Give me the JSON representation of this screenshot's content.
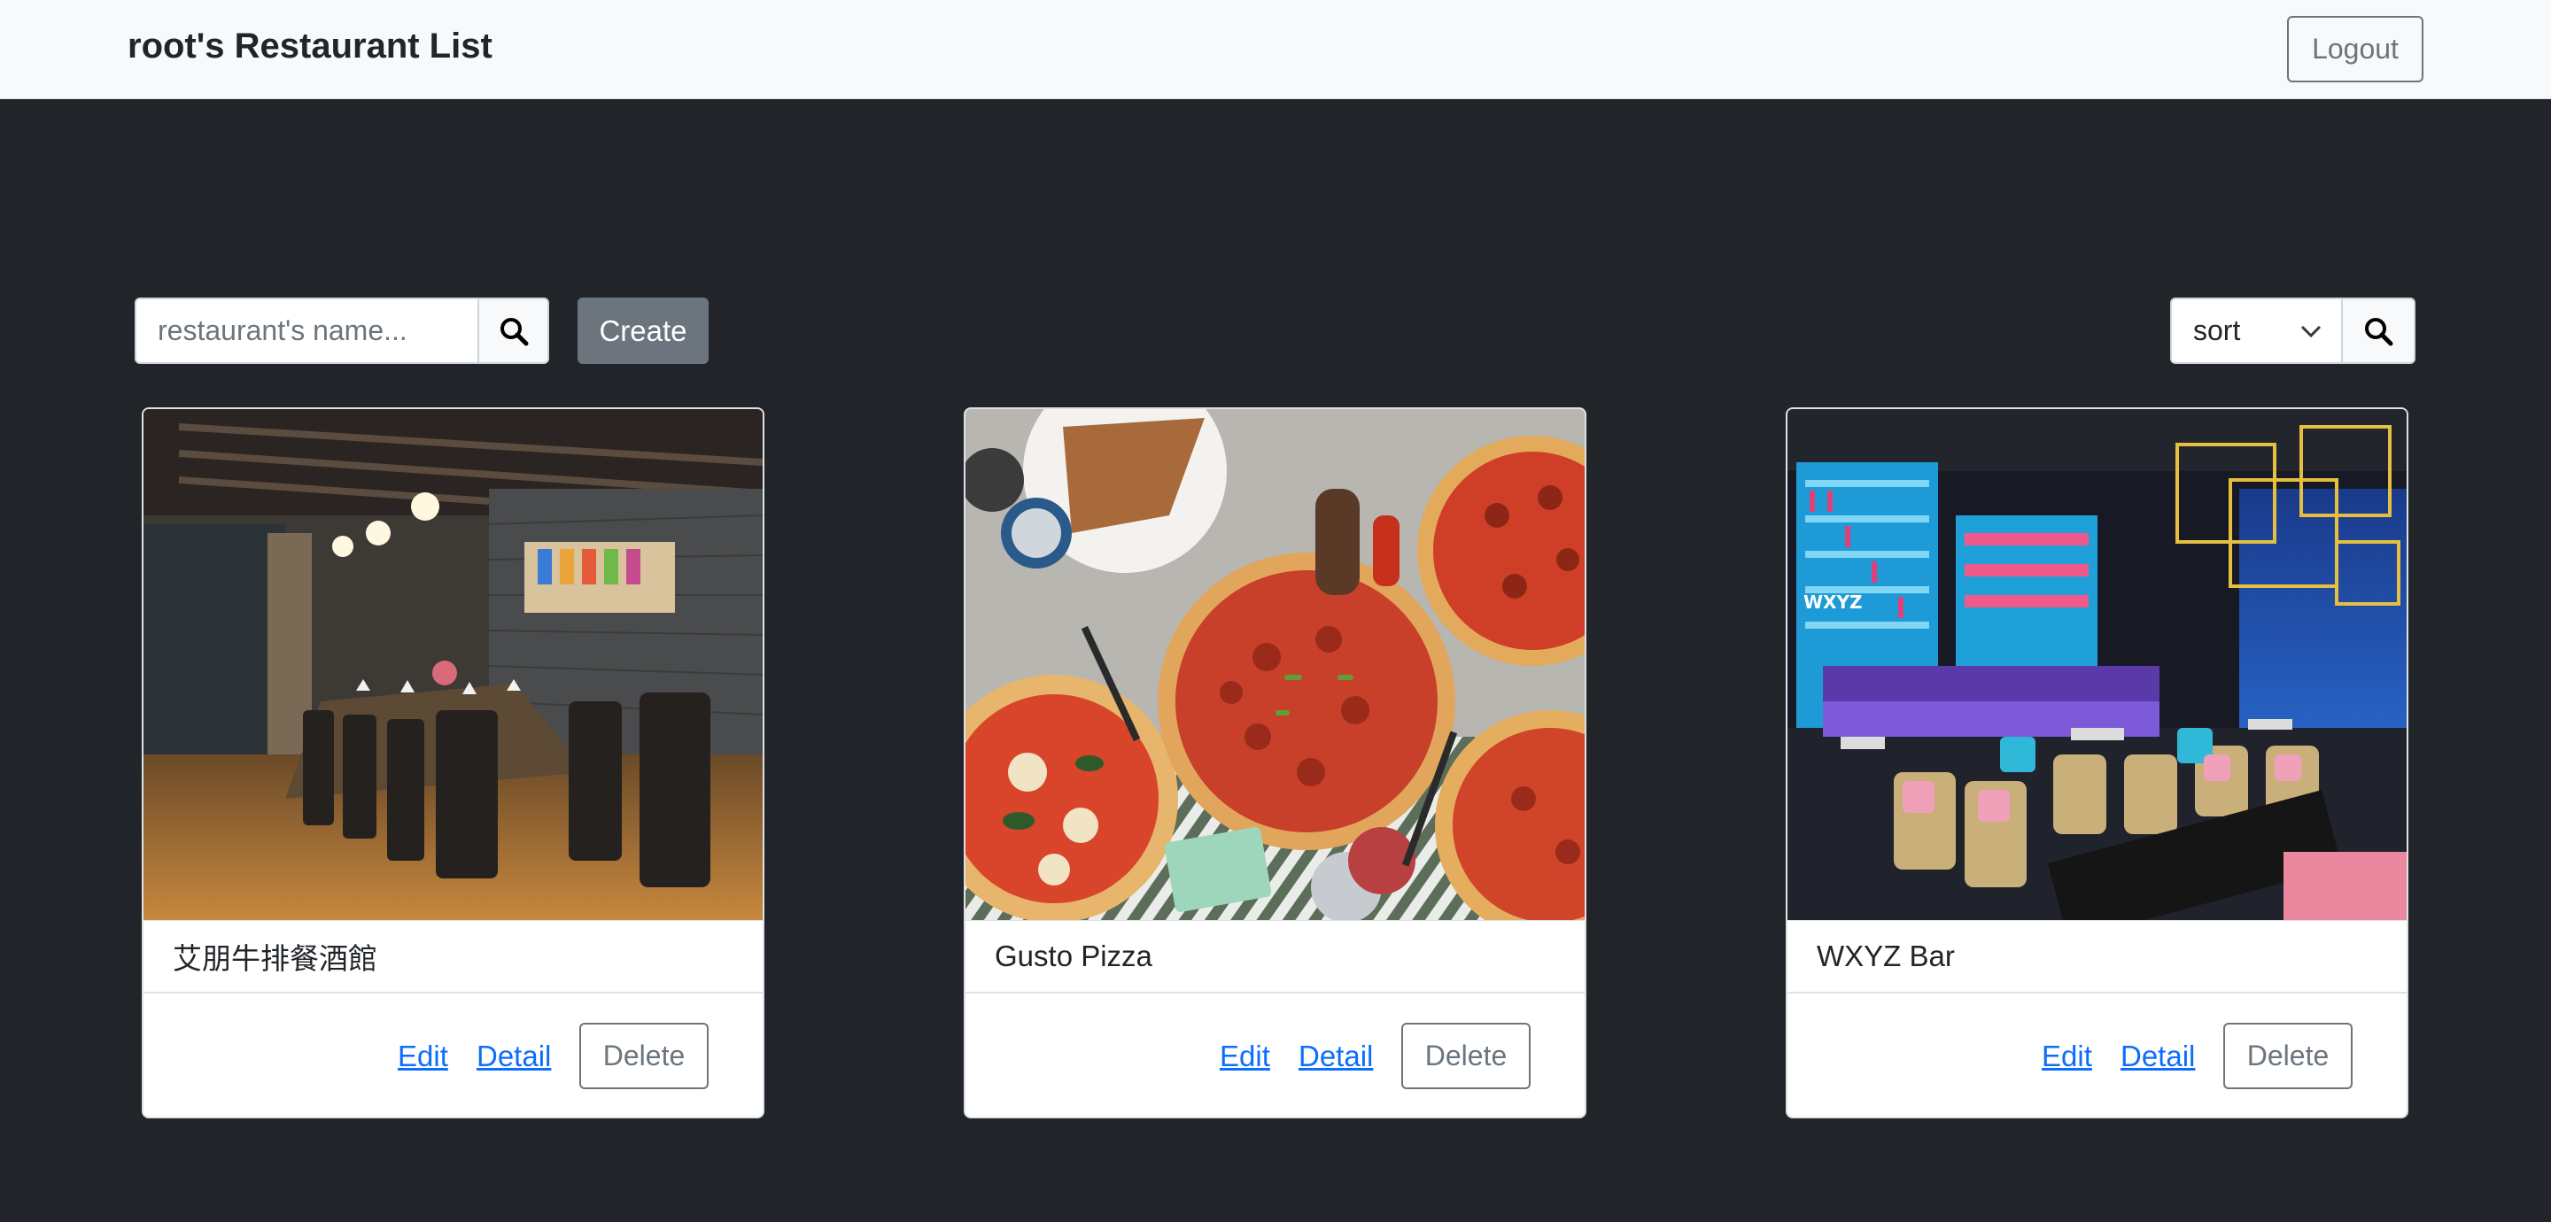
{
  "navbar": {
    "title": "root's Restaurant List",
    "logout_label": "Logout"
  },
  "toolbar": {
    "search_placeholder": "restaurant's name...",
    "search_icon": "search-icon",
    "create_label": "Create",
    "sort_value": "sort",
    "sort_icon": "chevron-down-icon",
    "sort_search_icon": "search-icon"
  },
  "restaurants": [
    {
      "name": "艾朋牛排餐酒館",
      "image_desc": "dining room photo",
      "edit_label": "Edit",
      "detail_label": "Detail",
      "delete_label": "Delete"
    },
    {
      "name": "Gusto Pizza",
      "image_desc": "pizza photo",
      "edit_label": "Edit",
      "detail_label": "Detail",
      "delete_label": "Delete"
    },
    {
      "name": "WXYZ Bar",
      "image_desc": "bar interior photo",
      "edit_label": "Edit",
      "detail_label": "Detail",
      "delete_label": "Delete"
    }
  ],
  "colors": {
    "page_bg": "#212529",
    "navbar_bg": "#f8f9fa",
    "link": "#0d6efd",
    "secondary": "#6c757d"
  }
}
